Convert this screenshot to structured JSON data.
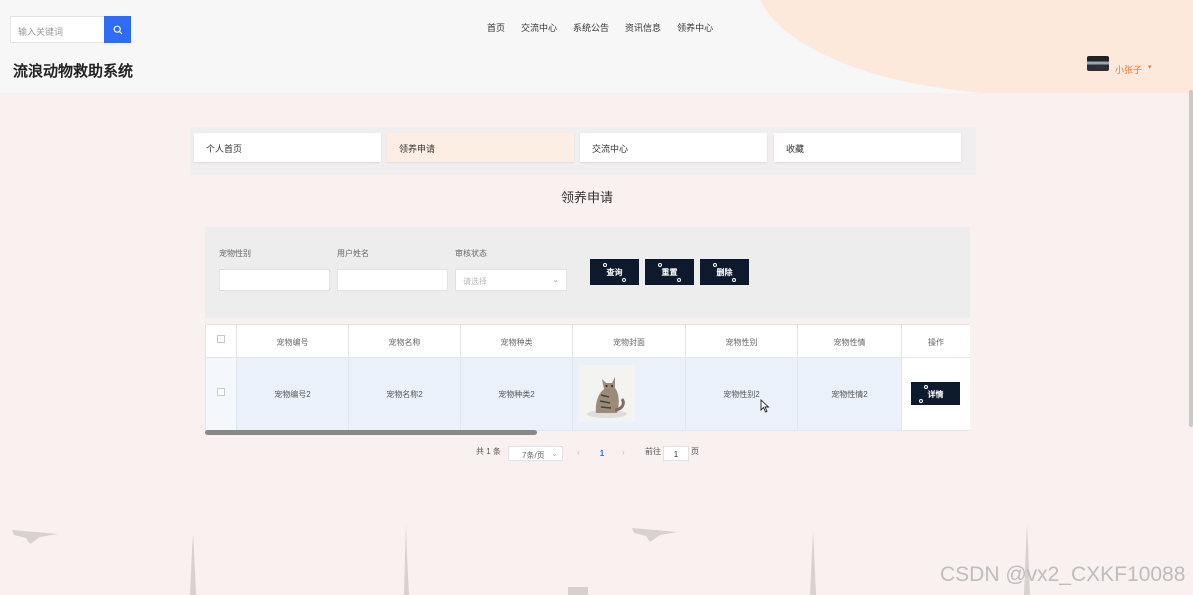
{
  "header": {
    "search_placeholder": "输入关键词",
    "nav": [
      "首页",
      "交流中心",
      "系统公告",
      "资讯信息",
      "领养中心"
    ],
    "site_title": "流浪动物救助系统",
    "username": "小张子",
    "caret": "▾"
  },
  "tabs": [
    {
      "label": "个人首页",
      "active": false
    },
    {
      "label": "领养申请",
      "active": true
    },
    {
      "label": "交流中心",
      "active": false
    },
    {
      "label": "收藏",
      "active": false
    }
  ],
  "page_heading": "领养申请",
  "filters": {
    "pet_gender_label": "宠物性别",
    "user_name_label": "用户姓名",
    "review_status_label": "审核状态",
    "review_status_placeholder": "请选择",
    "query_button": "查询",
    "reset_button": "重置",
    "delete_button": "删除"
  },
  "table": {
    "columns": [
      "宠物编号",
      "宠物名称",
      "宠物种类",
      "宠物封面",
      "宠物性别",
      "宠物性情",
      "操作"
    ],
    "rows": [
      {
        "id": "宠物编号2",
        "name": "宠物名称2",
        "kind": "宠物种类2",
        "gender": "宠物性别2",
        "temper": "宠物性情2",
        "action": "详情"
      }
    ]
  },
  "pagination": {
    "total": "共 1 条",
    "page_size": "7条/页",
    "prev": "‹",
    "current_page": "1",
    "next": "›",
    "goto_label": "前往",
    "goto_value": "1",
    "page_suffix": "页"
  },
  "watermark": "CSDN @vx2_CXKF10088",
  "colors": {
    "primary_blue": "#2f6cf6",
    "dark_button": "#0d1a2e",
    "accent_orange": "#e07b2a",
    "active_tab": "#fdeee4"
  }
}
